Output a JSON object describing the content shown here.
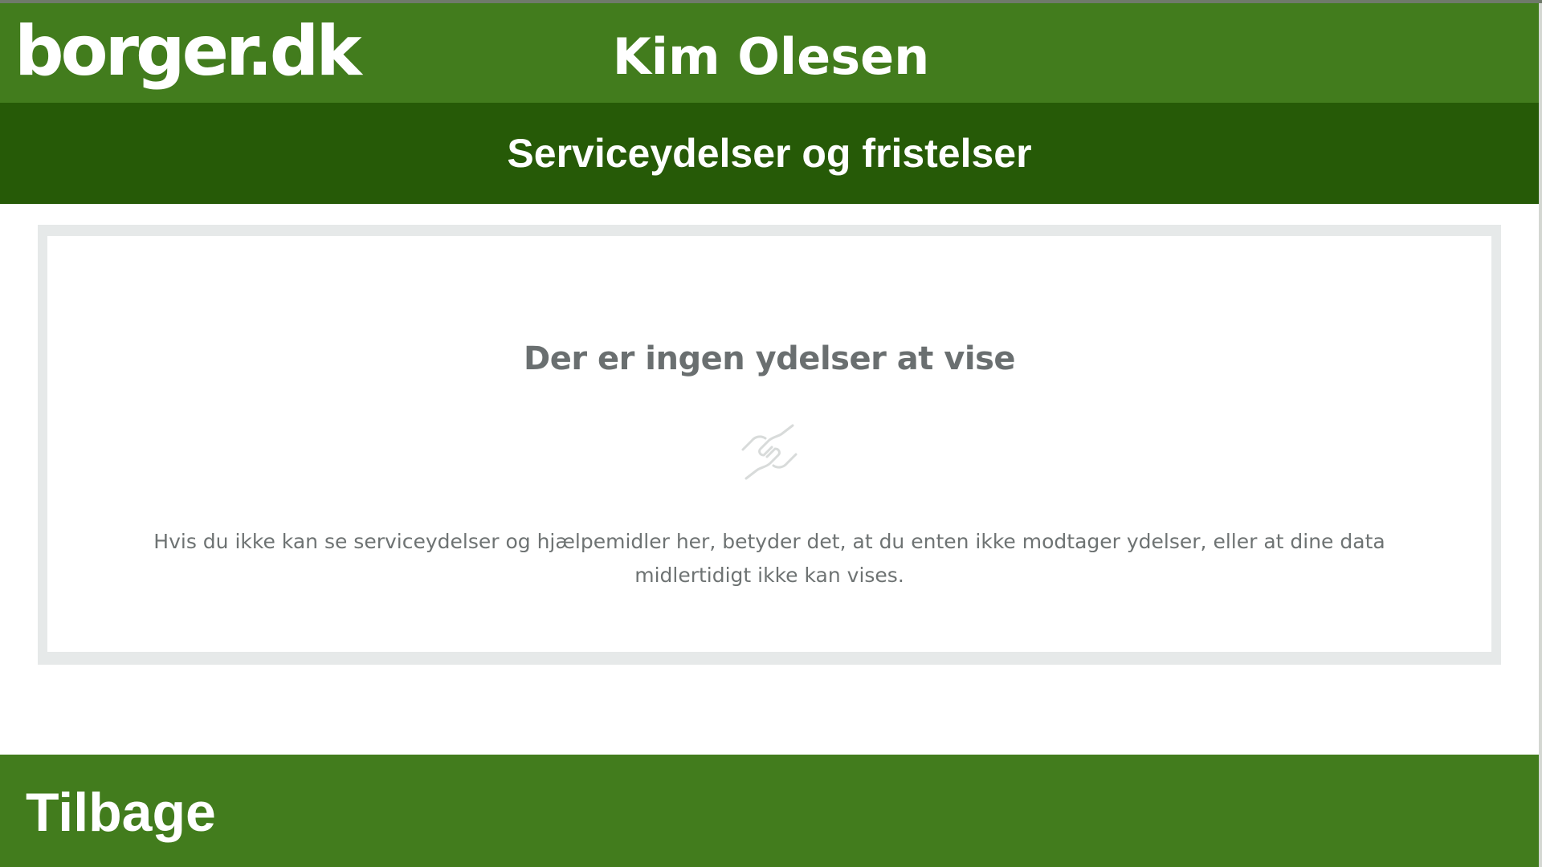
{
  "header": {
    "logo_text": "borger.dk",
    "user_name": "Kim Olesen"
  },
  "subheader": {
    "title": "Serviceydelser og fristelser"
  },
  "empty_state": {
    "title": "Der er ingen ydelser at vise",
    "icon": "handshake-icon",
    "message": "Hvis du ikke kan se serviceydelser og hjælpemidler her, betyder det, at du enten ikke modtager ydelser, eller at dine data midlertidigt ikke kan vises."
  },
  "footer": {
    "back_label": "Tilbage"
  },
  "colors": {
    "header_green": "#427c1d",
    "subheader_green": "#265a07",
    "card_border": "#e6e9e9",
    "muted_text": "#6a6f70"
  }
}
